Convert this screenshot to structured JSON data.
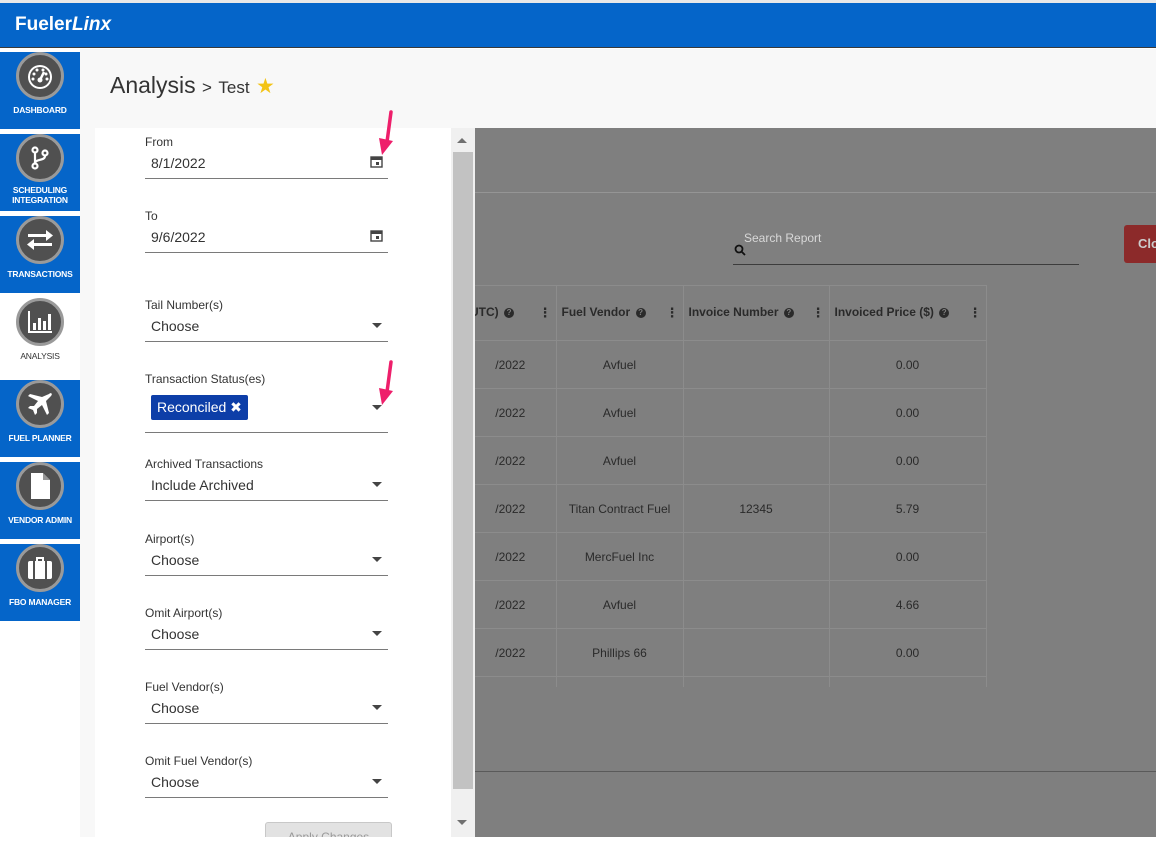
{
  "brand": {
    "name_plain": "Fueler",
    "name_italic": "Linx"
  },
  "colors": {
    "brand_blue": "#0565c9",
    "chip_blue": "#0d3ea8",
    "star": "#f3c316",
    "annotation": "#ee1f6b"
  },
  "sidebar": {
    "items": [
      {
        "label": "DASHBOARD",
        "icon": "speedometer-icon"
      },
      {
        "label": "SCHEDULING INTEGRATION",
        "icon": "branch-icon"
      },
      {
        "label": "TRANSACTIONS",
        "icon": "swap-arrows-icon"
      },
      {
        "label": "ANALYSIS",
        "icon": "bar-chart-icon",
        "active": true
      },
      {
        "label": "FUEL PLANNER",
        "icon": "airplane-icon"
      },
      {
        "label": "VENDOR ADMIN",
        "icon": "document-icon"
      },
      {
        "label": "FBO MANAGER",
        "icon": "briefcase-icon"
      }
    ]
  },
  "header": {
    "title": "Analysis",
    "separator": ">",
    "subtitle": "Test"
  },
  "filters": {
    "from": {
      "label": "From",
      "value": "8/1/2022"
    },
    "to": {
      "label": "To",
      "value": "9/6/2022"
    },
    "tail": {
      "label": "Tail Number(s)",
      "value": "Choose"
    },
    "status": {
      "label": "Transaction Status(es)",
      "chip": "Reconciled"
    },
    "archived": {
      "label": "Archived Transactions",
      "value": "Include Archived"
    },
    "airports": {
      "label": "Airport(s)",
      "value": "Choose"
    },
    "omit_airports": {
      "label": "Omit Airport(s)",
      "value": "Choose"
    },
    "vendors": {
      "label": "Fuel Vendor(s)",
      "value": "Choose"
    },
    "omit_vendors": {
      "label": "Omit Fuel Vendor(s)",
      "value": "Choose"
    },
    "apply_label": "Apply Changes"
  },
  "report": {
    "search_placeholder": "Search Report",
    "close_label": "Clo",
    "columns": [
      "UTC)",
      "Fuel Vendor",
      "Invoice Number",
      "Invoiced Price ($)"
    ],
    "rows": [
      [
        "/2022",
        "Avfuel",
        "",
        "0.00"
      ],
      [
        "/2022",
        "Avfuel",
        "",
        "0.00"
      ],
      [
        "/2022",
        "Avfuel",
        "",
        "0.00"
      ],
      [
        "/2022",
        "Titan Contract Fuel",
        "12345",
        "5.79"
      ],
      [
        "/2022",
        "MercFuel Inc",
        "",
        "0.00"
      ],
      [
        "/2022",
        "Avfuel",
        "",
        "4.66"
      ],
      [
        "/2022",
        "Phillips 66",
        "",
        "0.00"
      ]
    ]
  }
}
